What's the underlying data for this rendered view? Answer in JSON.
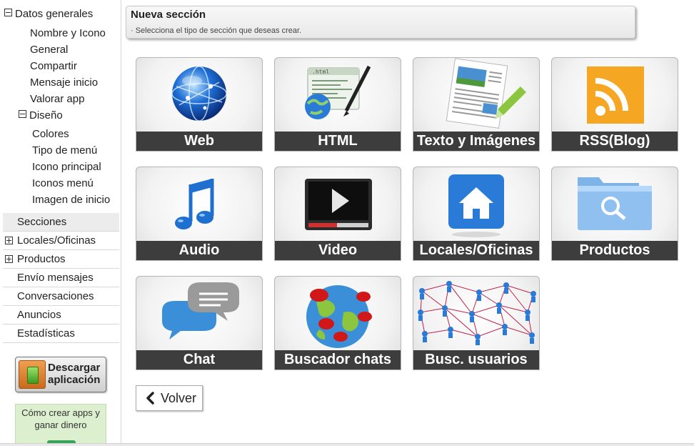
{
  "sidebar": {
    "tree": {
      "datos_generales": "Datos generales",
      "items": [
        "Nombre y Icono",
        "General",
        "Compartir",
        "Mensaje inicio",
        "Valorar app"
      ],
      "diseno": "Diseño",
      "diseno_items": [
        "Colores",
        "Tipo de menú",
        "Icono principal",
        "Iconos menú",
        "Imagen de inicio"
      ]
    },
    "menu": [
      "Secciones",
      "Locales/Oficinas",
      "Productos",
      "Envío mensajes",
      "Conversaciones",
      "Anuncios",
      "Estadísticas"
    ],
    "download_button": "Descargar aplicación",
    "promo": "Cómo crear apps y ganar dinero"
  },
  "header": {
    "title": "Nueva sección",
    "subtitle": "· Selecciona el tipo de sección que deseas crear."
  },
  "tiles": [
    "Web",
    "HTML",
    "Texto y Imágenes",
    "RSS(Blog)",
    "Audio",
    "Video",
    "Locales/Oficinas",
    "Productos",
    "Chat",
    "Buscador chats",
    "Busc. usuarios"
  ],
  "back_button": "Volver",
  "colors": {
    "tile_label_bg": "#3d3d3d",
    "rss_orange": "#f5a623",
    "active_row": "#ececec",
    "promo_bg": "#dcefcf"
  }
}
